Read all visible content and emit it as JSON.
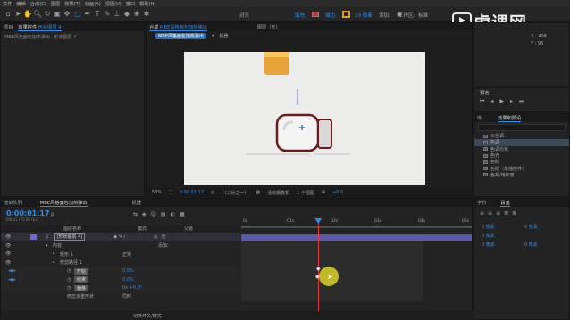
{
  "menu": [
    "文件",
    "编辑",
    "合成(C)",
    "图层",
    "效果(T)",
    "动画(A)",
    "视图(V)",
    "窗口",
    "帮助(H)"
  ],
  "toolbar": {
    "snap_label": "对齐",
    "fill_label": "填充:",
    "stroke_label": "描边:",
    "stroke_width": "10 像素",
    "add_label": "添加:",
    "workspace_label": "工作区:",
    "workspace_value": "标准",
    "colors": {
      "fill": "#d03030",
      "stroke": "#e0a020"
    }
  },
  "watermark": {
    "text": "虎课网",
    "icon": "play-logo-icon"
  },
  "project_panel": {
    "tabs": [
      "项目",
      "效果控件"
    ],
    "effect_target": "形状图层 4",
    "breadcrumb": "MBE风格面包加热弹出 · 形状图层 4"
  },
  "comp_panel": {
    "tab_label": "合成",
    "tab_comp_name": "MBE风格面包加热弹出",
    "layer_tab": "图层（无）",
    "breadcrumb_comp": "MBE风格面包加热弹出",
    "breadcrumb_child": "机器",
    "zoom": "50%",
    "timecode": "0:00:01:17",
    "resolution": "（二分之一）",
    "camera": "活动摄像机",
    "views": "1 个视图",
    "offset": "+0.0"
  },
  "info_panel": {
    "x_label": "X",
    "x_value": "408",
    "y_label": "Y",
    "y_value": "95"
  },
  "preview_panel": {
    "title": "预览"
  },
  "effects_panel": {
    "tabs": [
      "库",
      "效果和预设"
    ],
    "items": [
      "三色调",
      "色调",
      "色调均化",
      "色光",
      "色阶",
      "色阶（单独控件）",
      "色相/饱和度"
    ]
  },
  "paragraph_panel": {
    "tabs": [
      "字符",
      "段落"
    ],
    "spacing_values": [
      "0 像素",
      "0 像素",
      "0 像素",
      "0 像素",
      "0 像素"
    ]
  },
  "timeline": {
    "tabs": [
      "渲染队列",
      "MBE风格面包加热弹出",
      "机器"
    ],
    "timecode": "0:00:01:17",
    "frame_info": "00041 (25.00 fps)",
    "search_placeholder": "ρ",
    "columns": {
      "layer_name": "图层名称",
      "mode": "模式",
      "parent": "父级"
    },
    "layer": {
      "index": "1",
      "name": "[形状图层 4]",
      "mode": "正常",
      "parent": "无"
    },
    "rows": [
      {
        "label": "内容",
        "value": "",
        "extra": "添加:"
      },
      {
        "label": "矩形 1",
        "value": "正常",
        "extra": ""
      },
      {
        "label": "修剪路径 1",
        "value": "",
        "extra": ""
      },
      {
        "label": "开始",
        "value": "0.0%",
        "extra": ""
      },
      {
        "label": "结束",
        "value": "0.0%",
        "extra": ""
      },
      {
        "label": "偏移",
        "value": "0x +0.0°",
        "extra": ""
      },
      {
        "label": "修剪多重形状",
        "value": "同时",
        "extra": ""
      }
    ],
    "ruler": [
      "0s",
      "01s",
      "02s",
      "03s",
      "04s",
      "05s"
    ],
    "bottom_toggle": "切换开关/模式",
    "playhead_fraction": 0.35
  }
}
